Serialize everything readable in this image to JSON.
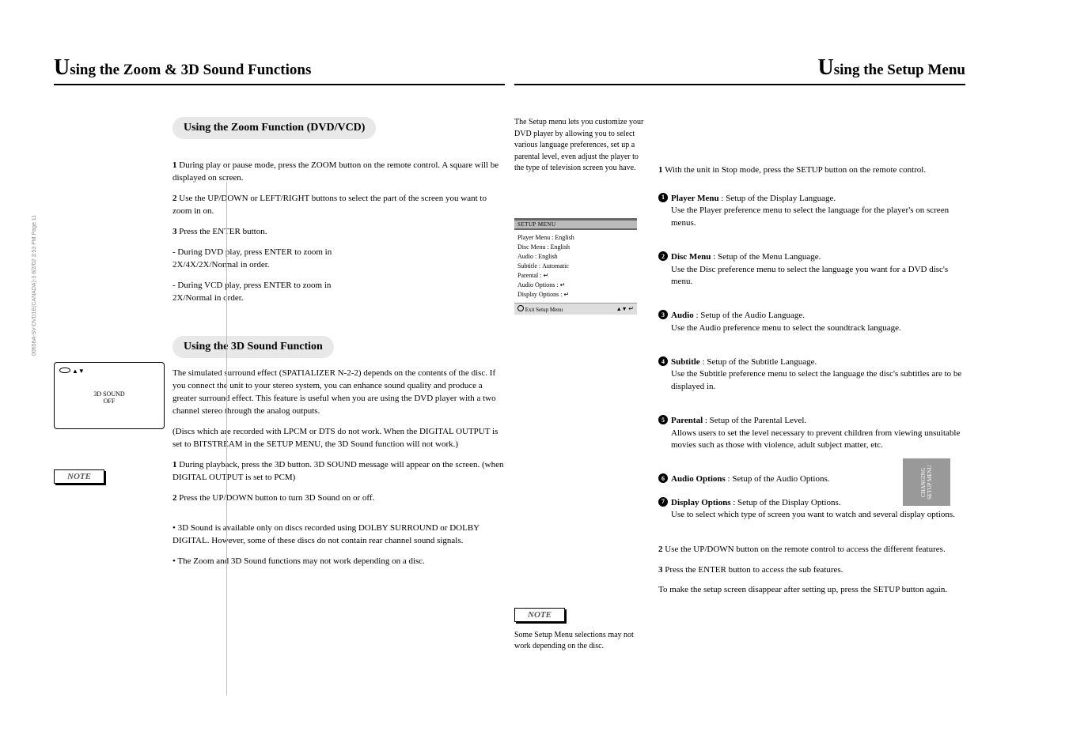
{
  "left": {
    "title_prefix": "U",
    "title_rest": "sing the Zoom & 3D Sound Functions",
    "zoom": {
      "pill": "Using the Zoom Function (DVD/VCD)",
      "p1": "During play or pause mode, press the ZOOM button on the remote control. A square will be displayed on screen.",
      "p2": "Use the UP/DOWN or LEFT/RIGHT buttons to select the part of the screen you want to zoom in on.",
      "p3": "Press the ENTER button.",
      "dvd_line1": "- During DVD play, press ENTER to zoom in",
      "dvd_line2": "2X/4X/2X/Normal in order.",
      "vcd_line1": "- During VCD play, press ENTER to zoom in",
      "vcd_line2": "2X/Normal in order."
    },
    "sound": {
      "pill": "Using the 3D Sound Function",
      "p1": "The simulated surround effect (SPATIALIZER N-2-2) depends on the contents of the disc. If you connect the unit to your stereo system, you can enhance sound quality and produce a greater surround effect. This feature is useful when you are using the DVD player with a two channel stereo through the analog outputs.",
      "p2": "(Discs which are recorded with LPCM or DTS do not work. When the DIGITAL OUTPUT is set to BITSTREAM in the SETUP MENU, the 3D Sound function will not work.)",
      "screen": {
        "shuttle": "SHUTTLE",
        "updown": "▲▼",
        "threeD": "3D SOUND",
        "off": "OFF"
      },
      "s1": "During playback, press the 3D button. 3D SOUND message will appear on the screen. (when DIGITAL OUTPUT is set to PCM)",
      "s2": "Press the UP/DOWN button to turn 3D Sound on or off."
    },
    "note": {
      "label": "NOTE",
      "n1": "• 3D Sound is available only on discs recorded using DOLBY SURROUND or DOLBY DIGITAL. However, some of these discs do not contain rear channel sound signals.",
      "n2": "• The Zoom and 3D Sound functions may not work depending on a disc."
    }
  },
  "right": {
    "title_prefix": "U",
    "title_rest": "sing the Setup Menu",
    "intro": "The Setup menu lets you customize your DVD player by allowing you to select various language preferences, set up a parental level, even adjust the player to the type of television screen you have.",
    "pstep": "With the unit in Stop mode, press the SETUP button on the remote control.",
    "items": [
      {
        "n": "1",
        "title": "Player Menu",
        "desc": ": Setup of the Display Language.",
        "desc2": "Use the Player preference menu to select the language for the player's on screen menus."
      },
      {
        "n": "2",
        "title": "Disc Menu",
        "desc": ": Setup of the Menu Language.",
        "desc2": "Use the Disc preference menu to select the language you want for a DVD disc's menu."
      },
      {
        "n": "3",
        "title": "Audio",
        "desc": ": Setup of the Audio Language.",
        "desc2": "Use the Audio preference menu to select the soundtrack language."
      },
      {
        "n": "4",
        "title": "Subtitle",
        "desc": ": Setup of the Subtitle Language.",
        "desc2": "Use the Subtitle preference menu to select the language the disc's subtitles are to be displayed in."
      },
      {
        "n": "5",
        "title": "Parental",
        "desc": ": Setup of the Parental Level.",
        "desc2": "Allows users to set the level necessary to prevent children from viewing unsuitable movies such as those with violence, adult subject matter, etc."
      },
      {
        "n": "6",
        "title": "Audio Options",
        "desc": ": Setup of the Audio Options."
      },
      {
        "n": "7",
        "title": "Display Options",
        "desc": ": Setup of the Display Options.",
        "desc2": "Use to select which type of screen you want to watch and several display options."
      }
    ],
    "setup_screen": {
      "title": "SETUP MENU",
      "rows": [
        {
          "label": "Player Menu",
          "val": "English"
        },
        {
          "label": "Disc Menu",
          "val": "English"
        },
        {
          "label": "Audio",
          "val": "English"
        },
        {
          "label": "Subtitle",
          "val": "Automatic"
        },
        {
          "label": "Parental",
          "val": ""
        },
        {
          "label": "Audio Options",
          "val": ""
        },
        {
          "label": "Display Options",
          "val": ""
        }
      ],
      "footer_exit": "Exit Setup Menu",
      "footer_nav": "▲▼",
      "enter_sym": "↵"
    },
    "steps": [
      "Use the UP/DOWN button on the remote control to access the different features.",
      "Press the ENTER button to access the sub features.",
      "To make the setup screen disappear after setting up, press the SETUP button again."
    ],
    "note": {
      "label": "NOTE",
      "n1": "Some Setup Menu selections may not work depending on the disc."
    },
    "tab": "CHANGING SETUP MENU"
  },
  "copyright": "00656A-SV-DVD1E(CANADA)-3  8/2/02 3:53 PM  Page 11"
}
